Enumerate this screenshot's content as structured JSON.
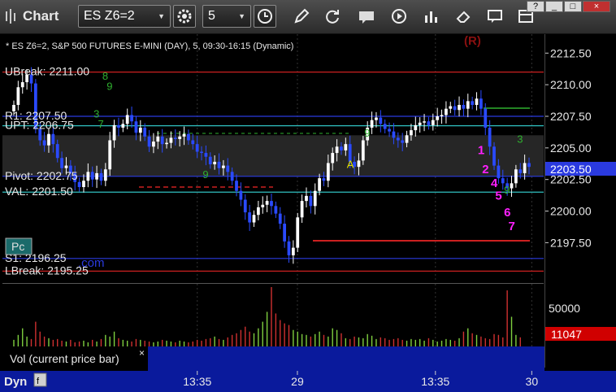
{
  "window": {
    "title": "Chart",
    "symbol": "ES Z6=2",
    "interval": "5",
    "controls": [
      "?",
      "_",
      "□",
      "×"
    ]
  },
  "chart_data": {
    "type": "candlestick",
    "title": "* ES Z6=2, S&P 500 FUTURES E-MINI (DAY), 5, 09:30-16:15 (Dynamic)",
    "watermark": "(R)",
    "ylim": [
      2194.5,
      2214
    ],
    "y_ticks": [
      2212.5,
      2210,
      2207.5,
      2205,
      2202.5,
      2200,
      2197.5
    ],
    "y_tick_labels": [
      "2212.50",
      "2210.00",
      "2207.50",
      "2205.00",
      "2202.50",
      "2200.00",
      "2197.50"
    ],
    "last_price": "2203.50",
    "last_price_value": 2203.5,
    "x_tick_labels": [
      {
        "label": "13:35",
        "pos": 0.36
      },
      {
        "label": "29",
        "pos": 0.545
      },
      {
        "label": "13:35",
        "pos": 0.8
      },
      {
        "label": "30",
        "pos": 0.978
      }
    ],
    "levels": [
      {
        "label": "UBreak: 2211.00",
        "value": 2211.0,
        "color": "#cc2020"
      },
      {
        "label": "R1: 2207.50",
        "value": 2207.5,
        "color": "#2a3adf"
      },
      {
        "label": "UPT: 2206.75",
        "value": 2206.75,
        "color": "#30c0c0"
      },
      {
        "label": "Pivot: 2202.75",
        "value": 2202.75,
        "color": "#2a3adf"
      },
      {
        "label": "VAL: 2201.50",
        "value": 2201.5,
        "color": "#30c0c0"
      },
      {
        "label": "S1: 2196.25",
        "value": 2196.25,
        "color": "#2a3adf"
      },
      {
        "label": "LBreak: 2195.25",
        "value": 2195.25,
        "color": "#cc2020"
      }
    ],
    "series": [
      {
        "name": "ES Z6=2",
        "closes": [
          2208.4,
          2209.8,
          2210.2,
          2210.8,
          2210.1,
          2206.5,
          2205.6,
          2205.2,
          2206.1,
          2205.3,
          2204.2,
          2203.4,
          2203.6,
          2203.0,
          2202.3,
          2201.9,
          2202.4,
          2203.1,
          2202.5,
          2203.0,
          2202.4,
          2203.3,
          2205.6,
          2206.8,
          2206.6,
          2206.9,
          2207.6,
          2207.1,
          2206.2,
          2206.6,
          2205.9,
          2205.1,
          2205.5,
          2205.9,
          2205.3,
          2205.4,
          2205.8,
          2205.7,
          2205.9,
          2206.1,
          2205.6,
          2205.3,
          2204.7,
          2204.6,
          2204.3,
          2203.7,
          2203.9,
          2203.4,
          2203.6,
          2203.1,
          2202.4,
          2201.6,
          2200.9,
          2199.9,
          2199.1,
          2199.7,
          2200.3,
          2200.5,
          2200.8,
          2200.4,
          2199.8,
          2199.0,
          2197.6,
          2196.5,
          2197.1,
          2199.5,
          2200.8,
          2201.2,
          2200.4,
          2201.6,
          2202.6,
          2202.4,
          2203.8,
          2204.6,
          2205.1,
          2204.8,
          2205.3,
          2203.9,
          2203.5,
          2204.0,
          2205.6,
          2206.6,
          2207.2,
          2207.4,
          2206.9,
          2206.5,
          2206.3,
          2205.8,
          2205.6,
          2205.4,
          2206.0,
          2206.4,
          2206.8,
          2207.0,
          2207.1,
          2206.8,
          2207.2,
          2207.5,
          2207.6,
          2208.1,
          2208.3,
          2208.0,
          2208.4,
          2208.1,
          2208.7,
          2208.4,
          2208.9,
          2208.1,
          2206.6,
          2205.1,
          2203.6,
          2202.6,
          2202.2,
          2201.8,
          2202.2,
          2203.3,
          2203.0,
          2203.8,
          2203.5
        ]
      }
    ],
    "setup_counts": [
      {
        "text": "8",
        "i": 21,
        "v": 2210.4,
        "color": "#2fb02f"
      },
      {
        "text": "9",
        "i": 22,
        "v": 2209.6,
        "color": "#2fb02f"
      },
      {
        "text": "3",
        "i": 19,
        "v": 2207.4,
        "color": "#2fb02f"
      },
      {
        "text": "7",
        "i": 20,
        "v": 2206.6,
        "color": "#2fb02f"
      },
      {
        "text": "9",
        "i": 44,
        "v": 2202.6,
        "color": "#2fb02f"
      },
      {
        "text": "9",
        "i": 81,
        "v": 2205.9,
        "color": "#2fb02f"
      },
      {
        "text": "A",
        "i": 77,
        "v": 2203.4,
        "color": "#e0e000"
      },
      {
        "text": "3",
        "i": 116,
        "v": 2205.4,
        "color": "#2fb02f"
      },
      {
        "text": "9",
        "i": 113,
        "v": 2201.4,
        "color": "#2fb02f"
      }
    ],
    "buy_counts": [
      {
        "text": "1",
        "i": 107,
        "v": 2204.5
      },
      {
        "text": "2",
        "i": 108,
        "v": 2203.0
      },
      {
        "text": "4",
        "i": 110,
        "v": 2201.9
      },
      {
        "text": "5",
        "i": 111,
        "v": 2200.9
      },
      {
        "text": "6",
        "i": 113,
        "v": 2199.6
      },
      {
        "text": "7",
        "i": 114,
        "v": 2198.5
      }
    ],
    "buy_count_color": "#ff20ff"
  },
  "volume": {
    "label": "Vol (current price bar)",
    "tick_label": "50000",
    "tick_value": 50000,
    "last_value": "11047",
    "last_value_num": 11047,
    "max": 72000,
    "values": [
      8000,
      14000,
      22000,
      12000,
      9000,
      30000,
      18000,
      12000,
      10000,
      8000,
      9000,
      7000,
      6000,
      8000,
      5000,
      6000,
      7000,
      5000,
      8000,
      6000,
      9000,
      14000,
      12000,
      18000,
      10000,
      8000,
      7000,
      6000,
      9000,
      8000,
      7000,
      6000,
      5000,
      6000,
      8000,
      7000,
      6000,
      5000,
      7000,
      6000,
      5000,
      6000,
      8000,
      7000,
      9000,
      10000,
      12000,
      9000,
      8000,
      11000,
      14000,
      16000,
      20000,
      24000,
      18000,
      16000,
      22000,
      30000,
      42000,
      72000,
      40000,
      32000,
      28000,
      26000,
      20000,
      18000,
      15000,
      14000,
      12000,
      15000,
      18000,
      14000,
      12000,
      22000,
      20000,
      16000,
      10000,
      9000,
      12000,
      11000,
      10000,
      15000,
      13000,
      9000,
      11000,
      10000,
      8000,
      9000,
      10000,
      8000,
      7000,
      9000,
      8000,
      9000,
      7000,
      10000,
      8000,
      6000,
      7000,
      9000,
      8000,
      7000,
      10000,
      18000,
      22000,
      16000,
      14000,
      12000,
      10000,
      9000,
      15000,
      14000,
      11000,
      68000,
      36000,
      14000,
      11047
    ],
    "up_color": "#7fcf3f",
    "down_color": "#cf3030"
  },
  "overlay": {
    "pc_label": "Pc",
    "com_text": ".com"
  },
  "bottom": {
    "tab_label": "Dyn",
    "close": "×"
  },
  "colors": {
    "up_candle": "#ffffff",
    "down_candle": "#2a4aff",
    "grid": "#333333",
    "value_area": "#262626"
  }
}
